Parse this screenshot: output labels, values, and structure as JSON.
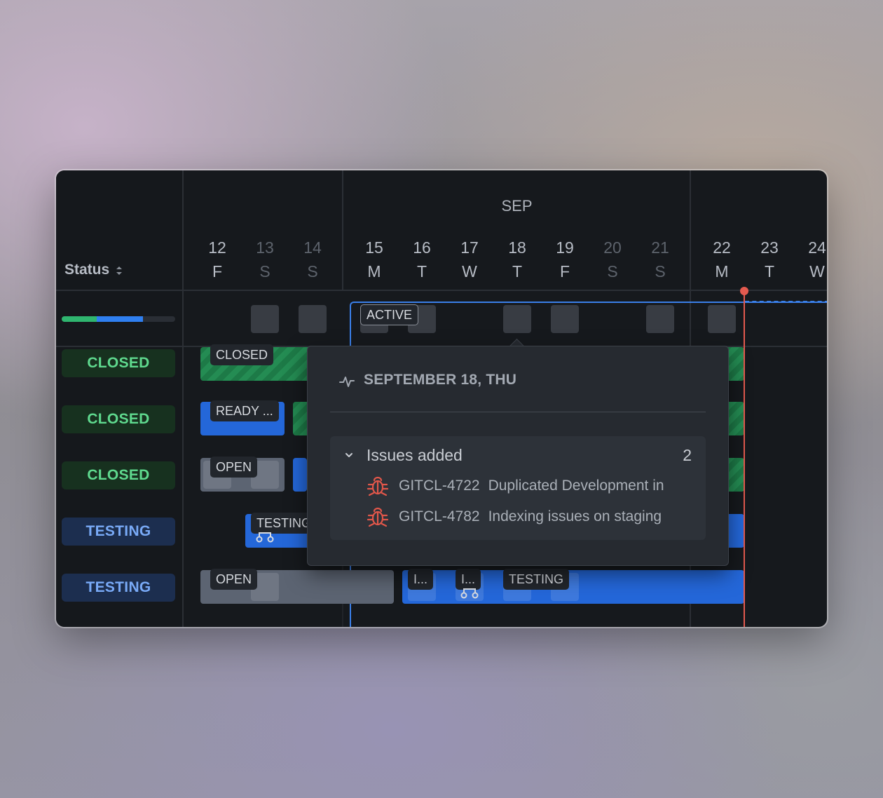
{
  "colors": {
    "accent": "#3a7fe8",
    "closed": "#5fd98e",
    "testing": "#79aaf7",
    "today": "#e45a4f",
    "bug": "#e2574a"
  },
  "left": {
    "status_header": "Status",
    "progress": {
      "closed_fraction": 0.31,
      "testing_fraction": 0.41
    },
    "rows": [
      {
        "status": "CLOSED",
        "kind": "closed"
      },
      {
        "status": "CLOSED",
        "kind": "closed"
      },
      {
        "status": "CLOSED",
        "kind": "closed"
      },
      {
        "status": "TESTING",
        "kind": "testing"
      },
      {
        "status": "TESTING",
        "kind": "testing"
      }
    ]
  },
  "timeline": {
    "month": "SEP",
    "days": [
      {
        "num": "12",
        "dow": "F",
        "weekend": false
      },
      {
        "num": "13",
        "dow": "S",
        "weekend": true
      },
      {
        "num": "14",
        "dow": "S",
        "weekend": true
      },
      {
        "num": "15",
        "dow": "M",
        "weekend": false
      },
      {
        "num": "16",
        "dow": "T",
        "weekend": false
      },
      {
        "num": "17",
        "dow": "W",
        "weekend": false
      },
      {
        "num": "18",
        "dow": "T",
        "weekend": false
      },
      {
        "num": "19",
        "dow": "F",
        "weekend": false
      },
      {
        "num": "20",
        "dow": "S",
        "weekend": true
      },
      {
        "num": "21",
        "dow": "S",
        "weekend": true
      },
      {
        "num": "22",
        "dow": "M",
        "weekend": false
      },
      {
        "num": "23",
        "dow": "T",
        "weekend": false
      },
      {
        "num": "24",
        "dow": "W",
        "weekend": false
      }
    ],
    "sprint_label": "ACTIVE",
    "bar_labels": {
      "r1": "CLOSED",
      "r2": "READY ...",
      "r3": "OPEN",
      "r4": "TESTING",
      "r5a": "OPEN",
      "r5b": "I...",
      "r5c": "I...",
      "r5d": "TESTING"
    }
  },
  "tooltip": {
    "date": "SEPTEMBER 18, THU",
    "section_title": "Issues added",
    "count": "2",
    "issues": [
      {
        "key": "GITCL-4722",
        "title": "Duplicated Development in"
      },
      {
        "key": "GITCL-4782",
        "title": "Indexing issues on staging"
      }
    ]
  }
}
